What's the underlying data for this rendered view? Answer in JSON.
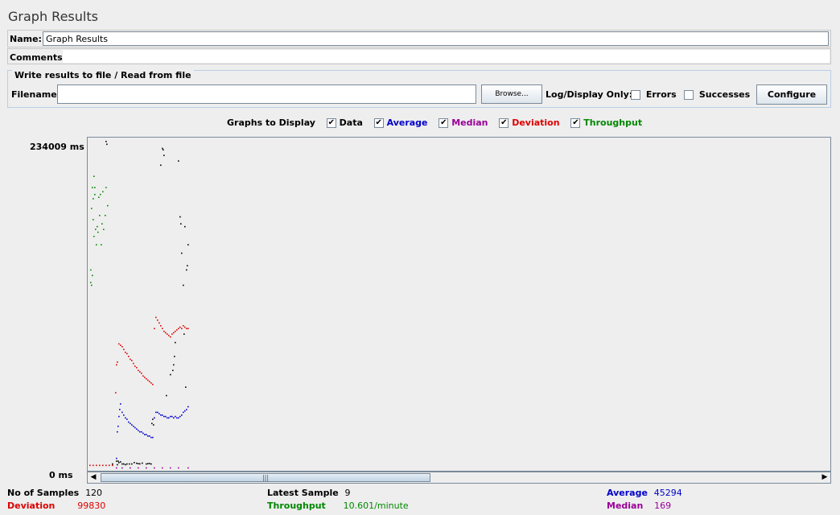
{
  "window": {
    "title": "Graph Results"
  },
  "form": {
    "name_label": "Name:",
    "name_value": "Graph Results",
    "comments_label": "Comments:",
    "comments_value": ""
  },
  "file_group": {
    "legend": "Write results to file / Read from file",
    "filename_label": "Filename",
    "filename_value": "",
    "browse_label": "Browse...",
    "log_display_label": "Log/Display Only:",
    "errors_label": "Errors",
    "errors_checked": false,
    "successes_label": "Successes",
    "successes_checked": false,
    "configure_label": "Configure"
  },
  "graphs": {
    "label": "Graphs to Display",
    "check_glyph": "✔",
    "items": [
      {
        "label": "Data",
        "checked": true,
        "color": "#000000"
      },
      {
        "label": "Average",
        "checked": true,
        "color": "#0000cc"
      },
      {
        "label": "Median",
        "checked": true,
        "color": "#990099"
      },
      {
        "label": "Deviation",
        "checked": true,
        "color": "#dd0000"
      },
      {
        "label": "Throughput",
        "checked": true,
        "color": "#008800"
      }
    ]
  },
  "chart": {
    "y_max_label": "234009",
    "y_min_label": "0",
    "y_unit": "ms"
  },
  "chart_data": {
    "type": "scatter",
    "ylim": [
      0,
      234009
    ],
    "x_label": "",
    "y_label": "",
    "colors": {
      "data": "#000000",
      "average": "#0000cc",
      "median": "#990099",
      "deviation": "#dd0000",
      "throughput": "#008800"
    },
    "series": [
      {
        "key": "throughput",
        "x": [
          1,
          1,
          2,
          2,
          3,
          3,
          4,
          4,
          5,
          5,
          6,
          6,
          7,
          8,
          9,
          10,
          11,
          12,
          13,
          14,
          15,
          16,
          17,
          19,
          20,
          22
        ],
        "y": [
          133000,
          142000,
          131000,
          186000,
          138000,
          201000,
          178000,
          193000,
          209000,
          166000,
          196000,
          201000,
          171000,
          160000,
          173000,
          169000,
          194000,
          181000,
          196000,
          160000,
          175000,
          198000,
          171000,
          181000,
          201000,
          188000
        ]
      },
      {
        "key": "data",
        "x": [
          20,
          21,
          28,
          33,
          34,
          35,
          36,
          38,
          40,
          42,
          44,
          46,
          49,
          52,
          55,
          58,
          60,
          62,
          65,
          70,
          72,
          74,
          76,
          77,
          78,
          79,
          88,
          90,
          91,
          92,
          95,
          100,
          103,
          104,
          105,
          106,
          110,
          112,
          113,
          114,
          116,
          117,
          118,
          119,
          120,
          121,
          122
        ],
        "y": [
          234000,
          232000,
          3000,
          5000,
          2500,
          5000,
          4000,
          4500,
          3000,
          3000,
          2500,
          3000,
          3000,
          3000,
          4000,
          3500,
          3200,
          3100,
          3600,
          3000,
          3200,
          3300,
          3000,
          32000,
          35000,
          31000,
          217000,
          229000,
          228000,
          224000,
          52000,
          67000,
          70000,
          74000,
          80000,
          90000,
          220000,
          180000,
          175000,
          154000,
          131000,
          96000,
          173000,
          58000,
          142000,
          145000,
          160000
        ]
      },
      {
        "key": "deviation",
        "x": [
          0,
          4,
          8,
          12,
          16,
          20,
          24,
          28,
          32,
          33,
          34,
          36,
          38,
          40,
          42,
          44,
          46,
          48,
          50,
          52,
          54,
          56,
          58,
          60,
          62,
          64,
          66,
          68,
          70,
          72,
          74,
          76,
          78,
          80,
          82,
          84,
          86,
          88,
          90,
          92,
          94,
          96,
          98,
          100,
          102,
          104,
          106,
          108,
          110,
          112,
          114,
          116,
          118,
          120,
          122
        ],
        "y": [
          2000,
          2000,
          2000,
          2000,
          2000,
          2000,
          2000,
          2000,
          54000,
          74000,
          76000,
          89000,
          88000,
          87000,
          85000,
          83000,
          82000,
          80000,
          78000,
          77000,
          75000,
          73000,
          72000,
          70000,
          69000,
          68000,
          66000,
          65000,
          64000,
          63000,
          62000,
          61000,
          60000,
          100000,
          108000,
          106000,
          104000,
          102000,
          100000,
          98000,
          97000,
          96000,
          95000,
          94000,
          96000,
          97000,
          98000,
          99000,
          100000,
          101000,
          100000,
          102000,
          101000,
          100000,
          100000
        ]
      },
      {
        "key": "average",
        "x": [
          33,
          34,
          35,
          36,
          37,
          38,
          40,
          42,
          44,
          46,
          48,
          50,
          52,
          54,
          56,
          58,
          60,
          62,
          64,
          66,
          68,
          70,
          72,
          74,
          76,
          78,
          80,
          82,
          84,
          86,
          88,
          90,
          92,
          94,
          96,
          98,
          100,
          102,
          104,
          106,
          108,
          110,
          112,
          114,
          116,
          118,
          120,
          122
        ],
        "y": [
          7000,
          26000,
          30000,
          37000,
          42000,
          46000,
          40000,
          38000,
          36000,
          35000,
          33000,
          32000,
          31000,
          30000,
          29000,
          28000,
          27000,
          26000,
          26000,
          25000,
          24000,
          24000,
          23000,
          23000,
          22000,
          22000,
          36000,
          40000,
          40000,
          39000,
          38000,
          38000,
          37000,
          37000,
          36000,
          36000,
          37000,
          37000,
          36000,
          37000,
          36000,
          36000,
          37000,
          38000,
          40000,
          41000,
          42000,
          44000
        ]
      },
      {
        "key": "median",
        "x": [
          33,
          40,
          50,
          60,
          70,
          80,
          90,
          100,
          110,
          122
        ],
        "y": [
          150,
          150,
          160,
          160,
          165,
          165,
          168,
          168,
          169,
          169
        ]
      }
    ]
  },
  "scrollbar": {
    "left_arrow": "◀",
    "right_arrow": "▶",
    "grip": "|||",
    "position": 0,
    "visible_fraction": 0.45
  },
  "stats": {
    "samples_label": "No of Samples",
    "samples_value": "120",
    "latest_label": "Latest Sample",
    "latest_value": "9",
    "average_label": "Average",
    "average_value": "45294",
    "deviation_label": "Deviation",
    "deviation_value": "99830",
    "throughput_label": "Throughput",
    "throughput_value": "10.601/minute",
    "median_label": "Median",
    "median_value": "169"
  }
}
